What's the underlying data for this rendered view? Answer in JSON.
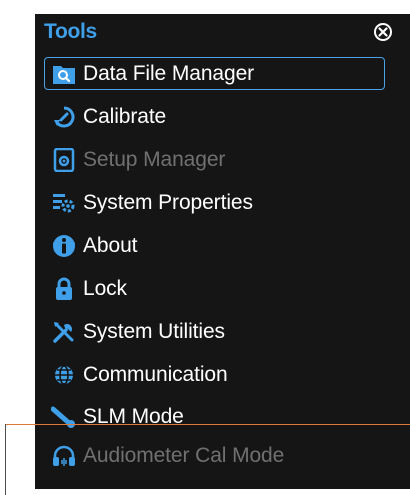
{
  "menu": {
    "title": "Tools",
    "items": [
      {
        "label": "Data File Manager",
        "icon": "search-folder-icon",
        "state": "selected"
      },
      {
        "label": "Calibrate",
        "icon": "calibrate-icon",
        "state": "normal"
      },
      {
        "label": "Setup Manager",
        "icon": "setup-document-icon",
        "state": "disabled"
      },
      {
        "label": "System Properties",
        "icon": "system-properties-icon",
        "state": "normal"
      },
      {
        "label": "About",
        "icon": "info-icon",
        "state": "normal"
      },
      {
        "label": "Lock",
        "icon": "lock-icon",
        "state": "normal"
      },
      {
        "label": "System Utilities",
        "icon": "tools-icon",
        "state": "normal"
      },
      {
        "label": "Communication",
        "icon": "globe-icon",
        "state": "normal"
      },
      {
        "label": "SLM Mode",
        "icon": "microphone-icon",
        "state": "normal"
      },
      {
        "label": "Audiometer Cal Mode",
        "icon": "headphones-icon",
        "state": "disabled"
      }
    ]
  },
  "colors": {
    "panel_bg": "#151515",
    "accent": "#3f9fe8",
    "text": "#ffffff",
    "disabled_text": "#707070",
    "callout": "#e07a3a"
  }
}
